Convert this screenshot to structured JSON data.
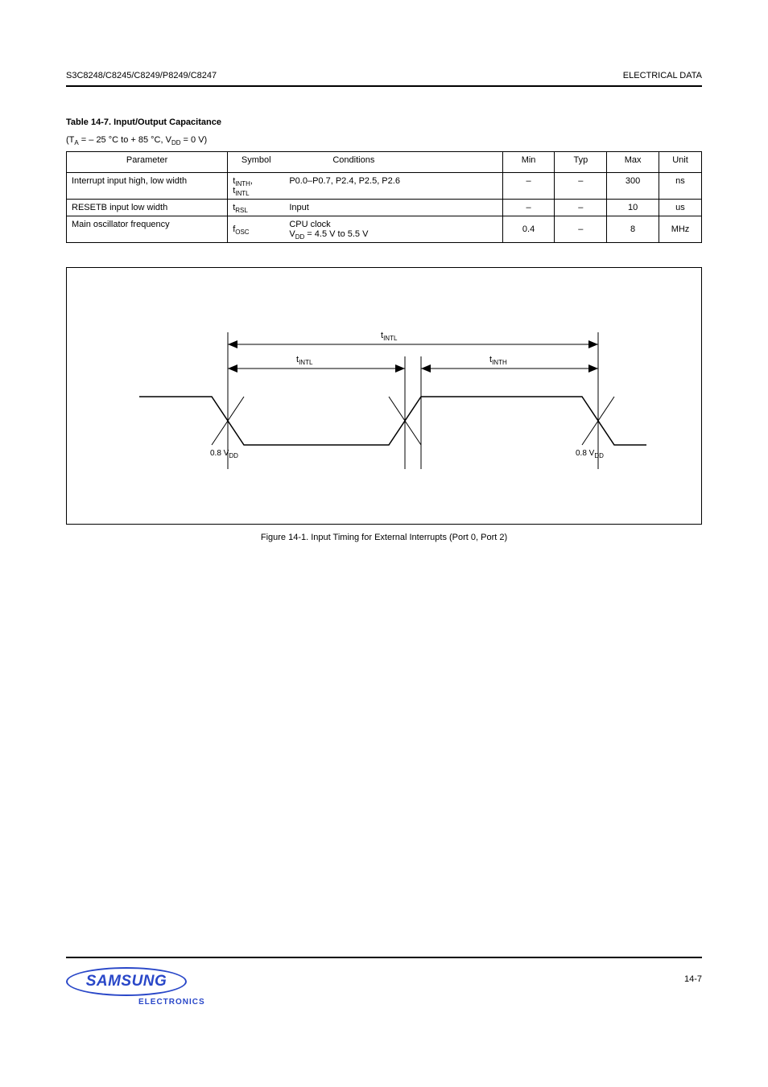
{
  "header": {
    "left": "S3C8248/C8245/C8249/P8249/C8247",
    "right": "ELECTRICAL DATA"
  },
  "section_title": "Table 14-7. Input/Output Capacitance",
  "condition_line_prefix": "(T",
  "condition_line_sub1": "A",
  "condition_line_mid": " = – 25 °C to + 85 °C, V",
  "condition_line_sub2": "DD",
  "condition_line_rest": " = 0 V)",
  "table": {
    "headers": [
      "Parameter",
      "Symbol",
      "Conditions",
      "Min",
      "Typ",
      "Max",
      "Unit"
    ],
    "rows": [
      {
        "parameter": "Interrupt input high, low width",
        "symbol_html": "t<sub>INTH</sub>,<br>t<sub>INTL</sub>",
        "symbol_plain": "tINTH, tINTL",
        "conditions": "P0.0–P0.7, P2.4, P2.5, P2.6",
        "min": "–",
        "typ": "–",
        "max": "300",
        "unit": "ns"
      },
      {
        "parameter": "RESETB input low width",
        "symbol_html": "t<sub>RSL</sub>",
        "symbol_plain": "tRSL",
        "conditions": "Input",
        "min": "–",
        "typ": "–",
        "max": "10",
        "unit": "us"
      },
      {
        "parameter": "Main oscillator frequency",
        "symbol_html": "f<sub>OSC</sub>",
        "symbol_plain": "fOSC",
        "conditions_html": "CPU clock<br>V<sub>DD</sub> = 4.5 V to 5.5 V",
        "conditions_plain": "CPU clock VDD = 4.5 V to 5.5 V",
        "min": "0.4",
        "typ": "–",
        "max": "8",
        "unit": "MHz"
      }
    ]
  },
  "figure": {
    "label_cycle": "t<sub>INTL</sub>",
    "label_low": "t<sub>INTL</sub>",
    "label_high": "t<sub>INTH</sub>",
    "voltage_low": "0.8 V<sub>DD</sub>",
    "voltage_high": "0.8 V<sub>DD</sub>",
    "caption": "Figure 14-1. Input Timing for External Interrupts (Port 0, Port 2)"
  },
  "logo": {
    "brand": "SAMSUNG",
    "sub": "ELECTRONICS"
  },
  "page_number": "14-7",
  "chart_data": {
    "type": "table",
    "title": "Input/Output Capacitance",
    "headers": [
      "Parameter",
      "Symbol",
      "Conditions",
      "Min",
      "Typ",
      "Max",
      "Unit"
    ],
    "rows": [
      [
        "Interrupt input high, low width",
        "tINTH, tINTL",
        "P0.0–P0.7, P2.4, P2.5, P2.6",
        null,
        null,
        300,
        "ns"
      ],
      [
        "RESETB input low width",
        "tRSL",
        "Input",
        null,
        null,
        10,
        "us"
      ],
      [
        "Main oscillator frequency",
        "fOSC",
        "CPU clock VDD = 4.5 V to 5.5 V",
        0.4,
        null,
        8,
        "MHz"
      ]
    ],
    "figure_timing": {
      "type": "timing-diagram",
      "signals": [
        "external-interrupt"
      ],
      "intervals": [
        "tINTL (low)",
        "tINTH (high)",
        "tINTL (cycle)"
      ],
      "threshold_label": "0.8 VDD"
    }
  }
}
